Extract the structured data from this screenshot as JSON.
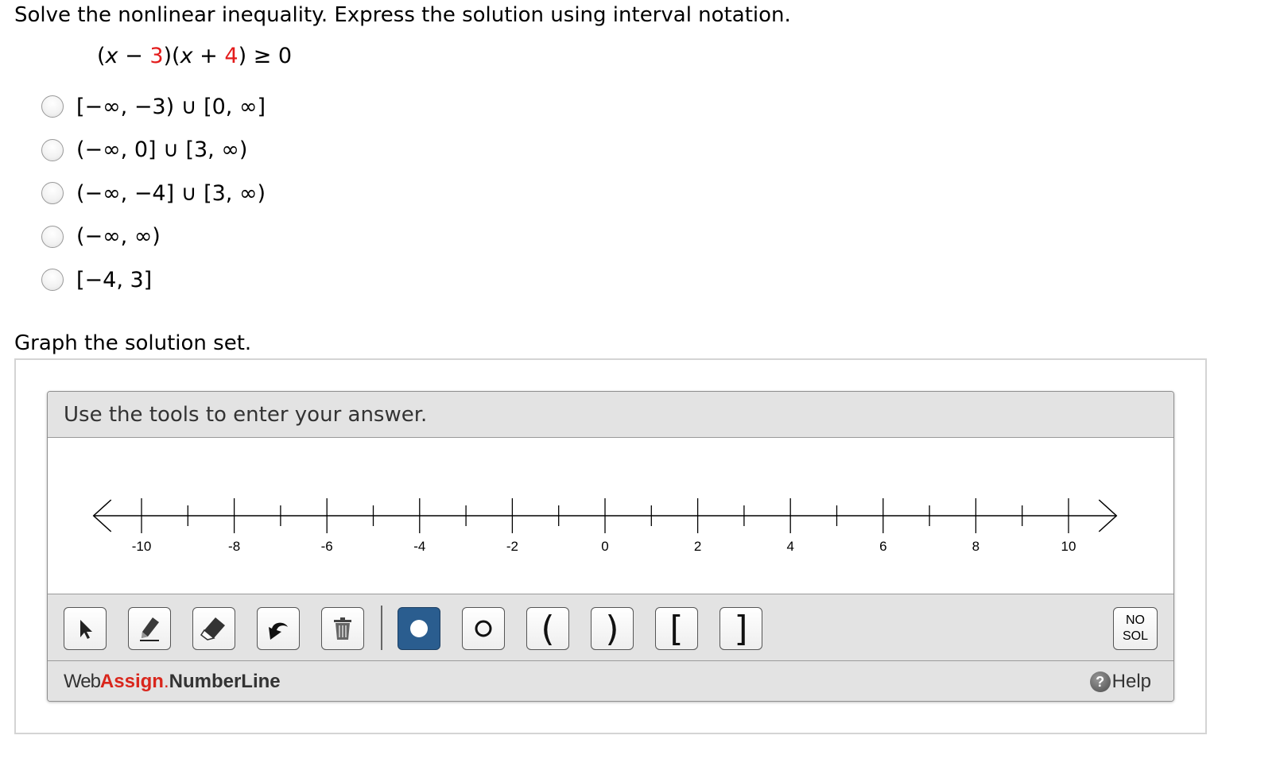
{
  "question": {
    "prompt": "Solve the nonlinear inequality. Express the solution using interval notation.",
    "equation": {
      "open1": "(",
      "var1": "x",
      "minus": " − ",
      "num1": "3",
      "close1": ")(",
      "var2": "x",
      "plus": " + ",
      "num2": "4",
      "rest": ") ≥ 0",
      "highlight_color": "#e31b1b"
    }
  },
  "choices": [
    {
      "label": "[−∞, −3) ∪ [0, ∞]"
    },
    {
      "label": "(−∞, 0] ∪ [3, ∞)"
    },
    {
      "label": "(−∞, −4] ∪ [3, ∞)"
    },
    {
      "label": "(−∞, ∞)"
    },
    {
      "label": "[−4, 3]"
    }
  ],
  "graph": {
    "label": "Graph the solution set.",
    "panel_header": "Use the tools to enter your answer.",
    "number_line": {
      "min": -11,
      "max": 11,
      "tick_labels": [
        "-10",
        "-8",
        "-6",
        "-4",
        "-2",
        "0",
        "2",
        "4",
        "6",
        "8",
        "10"
      ]
    },
    "tools": [
      {
        "name": "select-tool",
        "icon": "arrow-pointer-icon"
      },
      {
        "name": "pencil-tool",
        "icon": "pencil-icon"
      },
      {
        "name": "eraser-tool",
        "icon": "eraser-icon"
      },
      {
        "name": "undo-tool",
        "icon": "undo-arrow-icon"
      },
      {
        "name": "delete-tool",
        "icon": "trash-icon"
      },
      {
        "name": "closed-dot-tool",
        "icon": "closed-dot-icon",
        "active": true
      },
      {
        "name": "open-dot-tool",
        "icon": "open-dot-icon"
      },
      {
        "name": "left-paren-tool",
        "glyph": "("
      },
      {
        "name": "right-paren-tool",
        "glyph": ")"
      },
      {
        "name": "left-bracket-tool",
        "glyph": "["
      },
      {
        "name": "right-bracket-tool",
        "glyph": "]"
      }
    ],
    "no_solution": {
      "line1": "NO",
      "line2": "SOL"
    },
    "brand": {
      "web": "Web",
      "assign": "Assign",
      "dot": ".",
      "product": "NumberLine"
    },
    "help_label": "Help",
    "active_color": "#2a5d8f"
  }
}
